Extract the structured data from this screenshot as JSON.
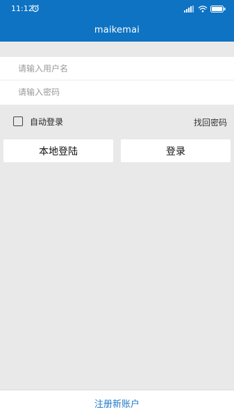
{
  "status_bar": {
    "time": "11:12",
    "icons": [
      "alarm-icon",
      "signal-icon",
      "wifi-icon",
      "battery-icon"
    ]
  },
  "header": {
    "title": "maikemai",
    "background_color": "#0e73c3"
  },
  "login_form": {
    "username_placeholder": "请输入用户名",
    "password_placeholder": "请输入密码",
    "auto_login_label": "自动登录",
    "auto_login_checked": false,
    "forgot_password_label": "找回密码",
    "local_login_button": "本地登陆",
    "login_button": "登录"
  },
  "footer": {
    "register_label": "注册新账户",
    "link_color": "#1f78c6"
  }
}
